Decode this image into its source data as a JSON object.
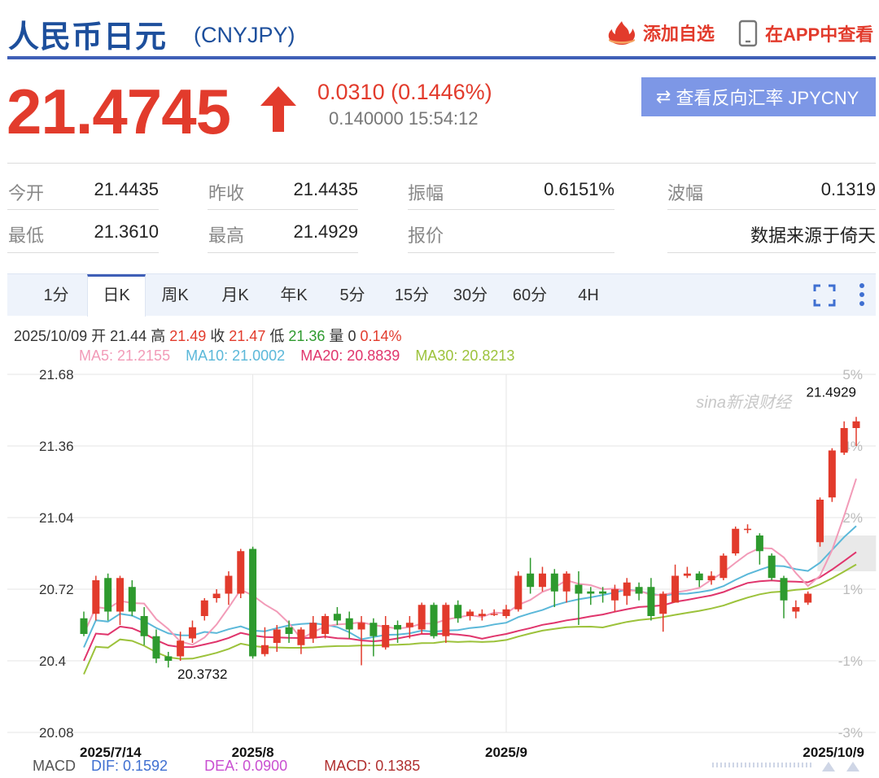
{
  "header": {
    "title": "人民币日元",
    "symbol": "(CNYJPY)",
    "add_watch": "添加自选",
    "view_app": "在APP中查看"
  },
  "quote": {
    "price": "21.4745",
    "change": "0.0310 (0.1446%)",
    "sub": "0.140000 15:54:12",
    "reverse_label": "查看反向汇率 JPYCNY"
  },
  "stats": {
    "open_label": "今开",
    "open_val": "21.4435",
    "prevclose_label": "昨收",
    "prevclose_val": "21.4435",
    "amplitude_label": "振幅",
    "amplitude_val": "0.6151%",
    "wave_label": "波幅",
    "wave_val": "0.1319",
    "low_label": "最低",
    "low_val": "21.3610",
    "high_label": "最高",
    "high_val": "21.4929",
    "quote_label": "报价",
    "source": "数据来源于倚天"
  },
  "tabs": [
    "1分",
    "日K",
    "周K",
    "月K",
    "年K",
    "5分",
    "15分",
    "30分",
    "60分",
    "4H"
  ],
  "active_tab": "日K",
  "info": {
    "date": "2025/10/09",
    "open_label": "开",
    "open": "21.44",
    "high_label": "高",
    "high": "21.49",
    "close_label": "收",
    "close": "21.47",
    "low_label": "低",
    "low": "21.36",
    "vol_label": "量",
    "vol": "0",
    "pct": "0.14%"
  },
  "ma": {
    "ma5": "MA5: 21.2155",
    "ma10": "MA10: 21.0002",
    "ma20": "MA20: 20.8839",
    "ma30": "MA30: 20.8213"
  },
  "macd": {
    "label": "MACD",
    "dif": "DIF: 0.1592",
    "dea": "DEA: 0.0900",
    "macd": "MACD: 0.1385"
  },
  "watermark": "sina新浪财经",
  "colors": {
    "up": "#e23b2c",
    "down": "#2e9a2e",
    "ma5": "#f29bb8",
    "ma10": "#5bb8d9",
    "ma20": "#e0356c",
    "ma30": "#9cc23b",
    "brand_blue": "#1d4f9c"
  },
  "chart_data": {
    "type": "candlestick",
    "y_ticks": [
      "21.68",
      "21.36",
      "21.04",
      "20.72",
      "20.4",
      "20.08"
    ],
    "pct_ticks": [
      "5%",
      "4%",
      "2%",
      "1%",
      "-1%",
      "-3%"
    ],
    "ylim": [
      20.08,
      21.68
    ],
    "x_ticks": [
      "2025/7/14",
      "2025/8",
      "2025/9",
      "2025/10/9"
    ],
    "x_tick_index": [
      0,
      14,
      35,
      63
    ],
    "max_label": "21.4929",
    "min_label": "20.3732",
    "candles": [
      [
        20.59,
        20.52,
        20.62,
        20.51
      ],
      [
        20.61,
        20.76,
        20.78,
        20.58
      ],
      [
        20.77,
        20.62,
        20.79,
        20.58
      ],
      [
        20.62,
        20.77,
        20.78,
        20.56
      ],
      [
        20.73,
        20.62,
        20.76,
        20.6
      ],
      [
        20.6,
        20.51,
        20.64,
        20.47
      ],
      [
        20.51,
        20.41,
        20.54,
        20.39
      ],
      [
        20.42,
        20.4,
        20.44,
        20.37
      ],
      [
        20.42,
        20.49,
        20.53,
        20.4
      ],
      [
        20.5,
        20.55,
        20.58,
        20.48
      ],
      [
        20.6,
        20.67,
        20.68,
        20.58
      ],
      [
        20.68,
        20.7,
        20.72,
        20.66
      ],
      [
        20.7,
        20.78,
        20.8,
        20.65
      ],
      [
        20.7,
        20.89,
        20.9,
        20.68
      ],
      [
        20.9,
        20.42,
        20.91,
        20.41
      ],
      [
        20.43,
        20.47,
        20.55,
        20.42
      ],
      [
        20.48,
        20.54,
        20.56,
        20.44
      ],
      [
        20.55,
        20.52,
        20.58,
        20.48
      ],
      [
        20.47,
        20.54,
        20.55,
        20.43
      ],
      [
        20.5,
        20.57,
        20.6,
        20.48
      ],
      [
        20.52,
        20.6,
        20.61,
        20.5
      ],
      [
        20.61,
        20.58,
        20.64,
        20.56
      ],
      [
        20.59,
        20.54,
        20.62,
        20.5
      ],
      [
        20.54,
        20.57,
        20.6,
        20.38
      ],
      [
        20.57,
        20.51,
        20.59,
        20.42
      ],
      [
        20.46,
        20.56,
        20.6,
        20.45
      ],
      [
        20.56,
        20.54,
        20.58,
        20.48
      ],
      [
        20.55,
        20.57,
        20.6,
        20.5
      ],
      [
        20.54,
        20.65,
        20.66,
        20.52
      ],
      [
        20.65,
        20.51,
        20.66,
        20.5
      ],
      [
        20.51,
        20.65,
        20.66,
        20.48
      ],
      [
        20.65,
        20.59,
        20.67,
        20.57
      ],
      [
        20.6,
        20.62,
        20.63,
        20.58
      ],
      [
        20.6,
        20.61,
        20.63,
        20.58
      ],
      [
        20.61,
        20.61,
        20.63,
        20.6
      ],
      [
        20.6,
        20.63,
        20.65,
        20.59
      ],
      [
        20.63,
        20.78,
        20.8,
        20.62
      ],
      [
        20.79,
        20.73,
        20.86,
        20.7
      ],
      [
        20.73,
        20.79,
        20.82,
        20.71
      ],
      [
        20.79,
        20.71,
        20.81,
        20.64
      ],
      [
        20.71,
        20.79,
        20.8,
        20.66
      ],
      [
        20.74,
        20.7,
        20.8,
        20.56
      ],
      [
        20.71,
        20.7,
        20.73,
        20.65
      ],
      [
        20.71,
        20.7,
        20.73,
        20.66
      ],
      [
        20.67,
        20.72,
        20.74,
        20.62
      ],
      [
        20.69,
        20.75,
        20.77,
        20.65
      ],
      [
        20.73,
        20.7,
        20.75,
        20.67
      ],
      [
        20.73,
        20.6,
        20.77,
        20.58
      ],
      [
        20.61,
        20.7,
        20.71,
        20.53
      ],
      [
        20.66,
        20.78,
        20.83,
        20.66
      ],
      [
        20.78,
        20.79,
        20.82,
        20.77
      ],
      [
        20.79,
        20.76,
        20.8,
        20.73
      ],
      [
        20.76,
        20.78,
        20.8,
        20.74
      ],
      [
        20.77,
        20.87,
        20.88,
        20.76
      ],
      [
        20.88,
        20.99,
        21.0,
        20.87
      ],
      [
        20.99,
        20.99,
        21.01,
        20.97
      ],
      [
        20.96,
        20.89,
        20.97,
        20.83
      ],
      [
        20.87,
        20.77,
        20.88,
        20.76
      ],
      [
        20.77,
        20.67,
        20.78,
        20.59
      ],
      [
        20.62,
        20.64,
        20.67,
        20.59
      ],
      [
        20.66,
        20.7,
        20.71,
        20.65
      ],
      [
        20.93,
        21.12,
        21.13,
        20.91
      ],
      [
        21.13,
        21.34,
        21.35,
        21.11
      ],
      [
        21.33,
        21.44,
        21.47,
        21.32
      ],
      [
        21.44,
        21.47,
        21.49,
        21.36
      ]
    ]
  }
}
